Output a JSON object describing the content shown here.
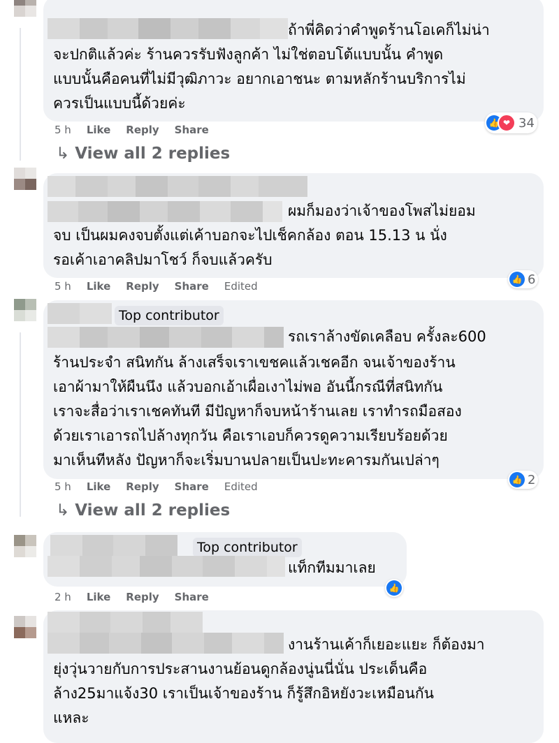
{
  "comments": [
    {
      "text_lines": [
        "ถ้าพี่คิดว่าคำพูดร้านโอเคก็ไม่น่า",
        "จะปกติแล้วค่ะ ร้านควรรับฟังลูกค้า ไม่ใช่ตอบโต้แบบนั้น คำพูด",
        "แบบนั้นคือคนที่ไม่มีวุฒิภาวะ อยากเอาชนะ ตามหลักร้านบริการไม่",
        "ควรเป็นแบบนี้ด้วยค่ะ"
      ],
      "time": "5 h",
      "like": "Like",
      "reply": "Reply",
      "share": "Share",
      "reaction_count": "34",
      "view_replies": "View all 2 replies"
    },
    {
      "text_lines": [
        "ผมก็มองว่าเจ้าของโพสไม่ยอม",
        "จบ เป็นผมคงจบตั้งแต่เค้าบอกจะไปเช็คกล้อง ตอน 15.13 น นั่ง",
        "รอเค้าเอาคลิปมาโชว์ ก็จบแล้วครับ"
      ],
      "time": "5 h",
      "like": "Like",
      "reply": "Reply",
      "share": "Share",
      "edited": "Edited",
      "reaction_count": "6"
    },
    {
      "badge": "Top contributor",
      "text_lines": [
        "รถเราล้างขัดเคลือบ ครั้งละ600",
        "ร้านประจำ สนิทกัน ล้างเสร็จเราเขชคแล้วเชคอีก จนเจ้าของร้าน",
        "เอาผ้ามาให้ผืนนึง แล้วบอกเอ้าเผื่อเงาไม่พอ อันนี้กรณีที่สนิทกัน",
        "เราจะสื่อว่าเราเชคทันที มีปัญหาก็จบหน้าร้านเลย เราทำรถมือสอง",
        "ด้วยเราเอารถไปล้างทุกวัน คือเราเอบก็ควรดูความเรียบร้อยด้วย",
        "มาเห็นทีหลัง ปัญหาก็จะเริ่มบานปลายเป็นปะทะคารมกันเปล่าๆ"
      ],
      "time": "5 h",
      "like": "Like",
      "reply": "Reply",
      "share": "Share",
      "edited": "Edited",
      "reaction_count": "2",
      "view_replies": "View all 2 replies"
    },
    {
      "badge": "Top contributor",
      "text_lines": [
        "แท็กทีมมาเลย"
      ],
      "time": "2 h",
      "like": "Like",
      "reply": "Reply",
      "share": "Share"
    },
    {
      "text_lines": [
        "งานร้านเค้าก็เยอะแยะ ก็ต้องมา",
        "ยุ่งวุ่นวายกับการประสานงานย้อนดูกล้องนู่นนี่นั่น ประเด็นคือ",
        "ล้าง25มาแจ้ง30 เราเป็นเจ้าของร้าน ก็รู้สึกอิหยังวะเหมือนกัน",
        "แหละ"
      ]
    }
  ],
  "colors": {
    "bubble": "#f0f2f5",
    "like_blue": "#1877f2",
    "love_red": "#f33e58",
    "meta_gray": "#65676b"
  },
  "icons": [
    "like-reaction-icon",
    "love-reaction-icon",
    "reply-arrow-icon"
  ]
}
